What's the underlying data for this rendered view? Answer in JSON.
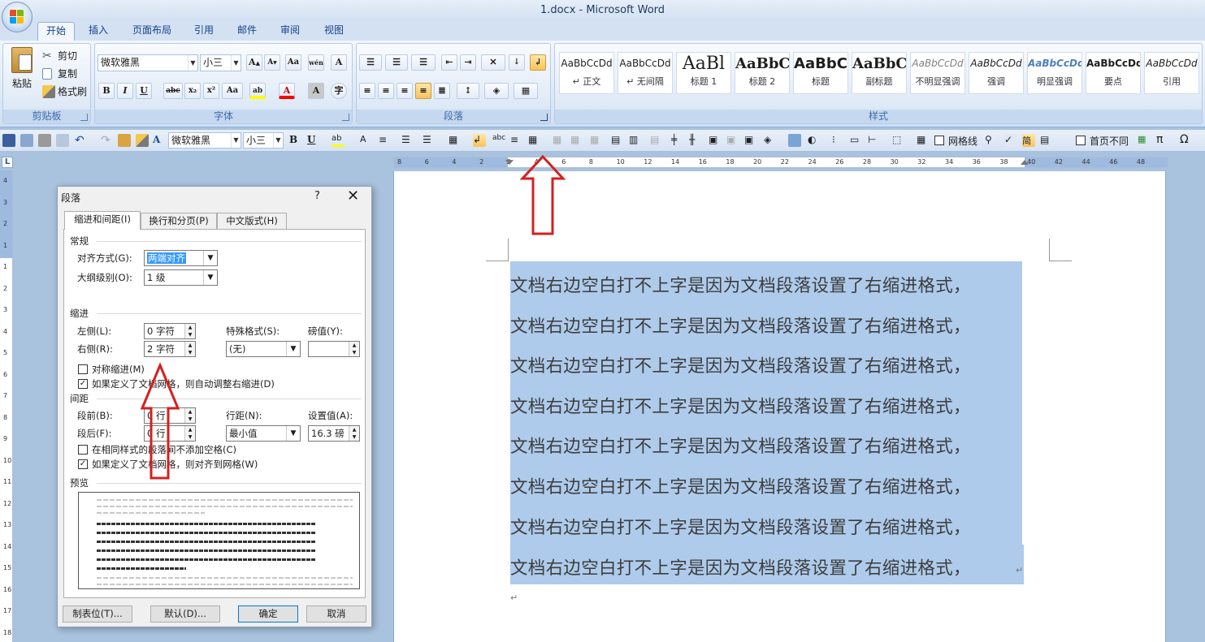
{
  "window": {
    "title": "1.docx - Microsoft Word"
  },
  "ribbon_tabs": [
    "开始",
    "插入",
    "页面布局",
    "引用",
    "邮件",
    "审阅",
    "视图"
  ],
  "clipboard": {
    "paste": "粘贴",
    "cut": "剪切",
    "copy": "复制",
    "format_painter": "格式刷",
    "group": "剪贴板"
  },
  "font": {
    "name": "微软雅黑",
    "size": "小三",
    "group": "字体"
  },
  "paragraph": {
    "group": "段落"
  },
  "styles": {
    "group": "样式",
    "items": [
      {
        "sample": "AaBbCcDd",
        "name": "↵ 正文"
      },
      {
        "sample": "AaBbCcDd",
        "name": "↵ 无间隔"
      },
      {
        "sample": "AaBl",
        "name": "标题 1"
      },
      {
        "sample": "AaBbC",
        "name": "标题 2"
      },
      {
        "sample": "AaBbC",
        "name": "标题"
      },
      {
        "sample": "AaBbC",
        "name": "副标题"
      },
      {
        "sample": "AaBbCcDd",
        "name": "不明显强调"
      },
      {
        "sample": "AaBbCcDd",
        "name": "强调"
      },
      {
        "sample": "AaBbCcDd",
        "name": "明显强调"
      },
      {
        "sample": "AaBbCcDd",
        "name": "要点"
      },
      {
        "sample": "AaBbCcDd",
        "name": "引用"
      }
    ]
  },
  "qat": {
    "font": "微软雅黑",
    "size": "小三",
    "gridlines": "网格线",
    "first_page_diff": "首页不同",
    "pi": "π",
    "omega": "Ω"
  },
  "ruler": {
    "h_labels": [
      "8",
      "6",
      "4",
      "2",
      "2",
      "4",
      "6",
      "8",
      "10",
      "12",
      "14",
      "16",
      "18",
      "20",
      "22",
      "24",
      "26",
      "28",
      "30",
      "32",
      "34",
      "36",
      "38",
      "40",
      "42",
      "44",
      "46",
      "48"
    ],
    "v_labels": [
      "4",
      "3",
      "2",
      "1",
      "1",
      "2",
      "3",
      "4",
      "5",
      "6",
      "7",
      "8",
      "9",
      "10",
      "11",
      "12",
      "13",
      "14",
      "15",
      "16",
      "17",
      "18"
    ],
    "corner": "L"
  },
  "document": {
    "lines": [
      "文档右边空白打不上字是因为文档段落设置了右缩进格式，",
      "文档右边空白打不上字是因为文档段落设置了右缩进格式，",
      "文档右边空白打不上字是因为文档段落设置了右缩进格式，",
      "文档右边空白打不上字是因为文档段落设置了右缩进格式，",
      "文档右边空白打不上字是因为文档段落设置了右缩进格式，",
      "文档右边空白打不上字是因为文档段落设置了右缩进格式，",
      "文档右边空白打不上字是因为文档段落设置了右缩进格式，",
      "文档右边空白打不上字是因为文档段落设置了右缩进格式，"
    ],
    "paragraph_mark": "↵"
  },
  "dialog": {
    "title": "段落",
    "help": "?",
    "close": "✕",
    "tabs": [
      "缩进和间距(I)",
      "换行和分页(P)",
      "中文版式(H)"
    ],
    "general": {
      "section": "常规",
      "alignment_label": "对齐方式(G):",
      "alignment_value": "两端对齐",
      "outline_label": "大纲级别(O):",
      "outline_value": "1 级"
    },
    "indent": {
      "section": "缩进",
      "left_label": "左侧(L):",
      "left_value": "0 字符",
      "right_label": "右侧(R):",
      "right_value": "2 字符",
      "special_label": "特殊格式(S):",
      "special_value": "(无)",
      "by_label": "磅值(Y):",
      "by_value": "",
      "mirror_label": "对称缩进(M)",
      "mirror_checked": false,
      "auto_adjust_label": "如果定义了文档网格，则自动调整右缩进(D)",
      "auto_adjust_checked": true
    },
    "spacing": {
      "section": "间距",
      "before_label": "段前(B):",
      "before_value": "0 行",
      "after_label": "段后(F):",
      "after_value": "0 行",
      "line_label": "行距(N):",
      "line_value": "最小值",
      "at_label": "设置值(A):",
      "at_value": "16.3 磅",
      "no_space_label": "在相同样式的段落间不添加空格(C)",
      "no_space_checked": false,
      "snap_grid_label": "如果定义了文档网格，则对齐到网格(W)",
      "snap_grid_checked": true
    },
    "preview": {
      "section": "预览"
    },
    "buttons": {
      "tabs": "制表位(T)...",
      "default": "默认(D)...",
      "ok": "确定",
      "cancel": "取消"
    }
  },
  "colors": {
    "selection": "#aecbeb",
    "annotation_arrow": "#d42020",
    "ribbon_text": "#15428b"
  }
}
